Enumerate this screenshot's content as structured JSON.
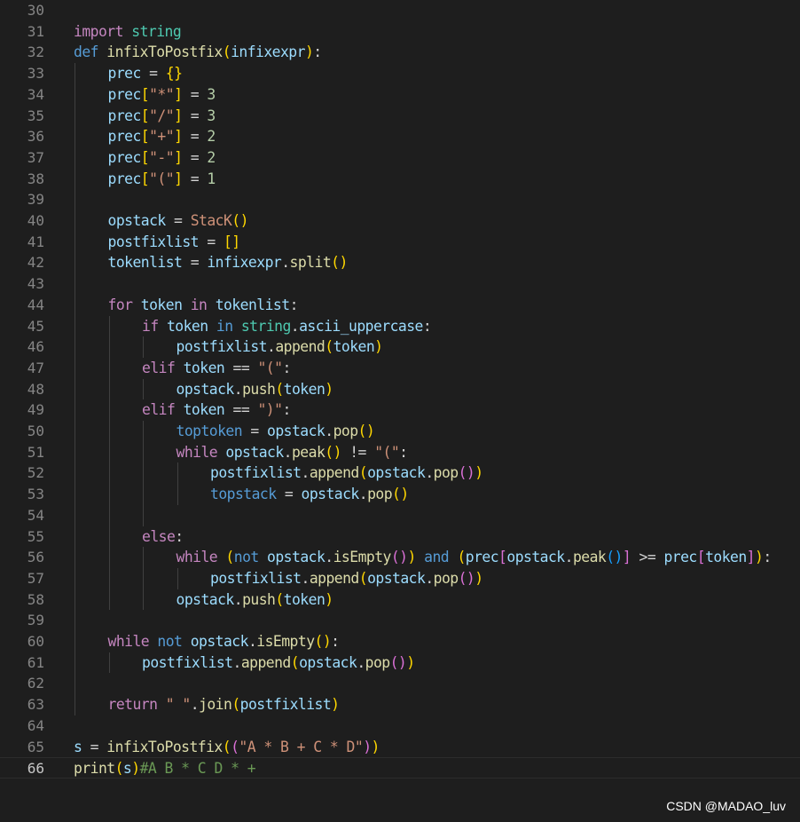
{
  "editor": {
    "language": "python",
    "current_line": 66,
    "lines": [
      {
        "n": 30,
        "indent": 0,
        "tokens": []
      },
      {
        "n": 31,
        "indent": 0,
        "tokens": [
          [
            "kw",
            "import"
          ],
          [
            "op",
            " "
          ],
          [
            "cls",
            "string"
          ]
        ]
      },
      {
        "n": 32,
        "indent": 0,
        "tokens": [
          [
            "def",
            "def"
          ],
          [
            "op",
            " "
          ],
          [
            "fn",
            "infixToPostfix"
          ],
          [
            "b1",
            "("
          ],
          [
            "var",
            "infixexpr"
          ],
          [
            "b1",
            ")"
          ],
          [
            "op",
            ":"
          ]
        ]
      },
      {
        "n": 33,
        "indent": 1,
        "tokens": [
          [
            "var",
            "prec"
          ],
          [
            "op",
            " = "
          ],
          [
            "b1",
            "{}"
          ]
        ]
      },
      {
        "n": 34,
        "indent": 1,
        "tokens": [
          [
            "var",
            "prec"
          ],
          [
            "b1",
            "["
          ],
          [
            "str",
            "\"*\""
          ],
          [
            "b1",
            "]"
          ],
          [
            "op",
            " = "
          ],
          [
            "num",
            "3"
          ]
        ]
      },
      {
        "n": 35,
        "indent": 1,
        "tokens": [
          [
            "var",
            "prec"
          ],
          [
            "b1",
            "["
          ],
          [
            "str",
            "\"/\""
          ],
          [
            "b1",
            "]"
          ],
          [
            "op",
            " = "
          ],
          [
            "num",
            "3"
          ]
        ]
      },
      {
        "n": 36,
        "indent": 1,
        "tokens": [
          [
            "var",
            "prec"
          ],
          [
            "b1",
            "["
          ],
          [
            "str",
            "\"+\""
          ],
          [
            "b1",
            "]"
          ],
          [
            "op",
            " = "
          ],
          [
            "num",
            "2"
          ]
        ]
      },
      {
        "n": 37,
        "indent": 1,
        "tokens": [
          [
            "var",
            "prec"
          ],
          [
            "b1",
            "["
          ],
          [
            "str",
            "\"-\""
          ],
          [
            "b1",
            "]"
          ],
          [
            "op",
            " = "
          ],
          [
            "num",
            "2"
          ]
        ]
      },
      {
        "n": 38,
        "indent": 1,
        "tokens": [
          [
            "var",
            "prec"
          ],
          [
            "b1",
            "["
          ],
          [
            "str",
            "\"(\""
          ],
          [
            "b1",
            "]"
          ],
          [
            "op",
            " = "
          ],
          [
            "num",
            "1"
          ]
        ]
      },
      {
        "n": 39,
        "indent": 1,
        "tokens": []
      },
      {
        "n": 40,
        "indent": 1,
        "tokens": [
          [
            "var",
            "opstack"
          ],
          [
            "op",
            " = "
          ],
          [
            "str",
            "StacK"
          ],
          [
            "b1",
            "()"
          ]
        ]
      },
      {
        "n": 41,
        "indent": 1,
        "tokens": [
          [
            "var",
            "postfixlist"
          ],
          [
            "op",
            " = "
          ],
          [
            "b1",
            "[]"
          ]
        ]
      },
      {
        "n": 42,
        "indent": 1,
        "tokens": [
          [
            "var",
            "tokenlist"
          ],
          [
            "op",
            " = "
          ],
          [
            "var",
            "infixexpr"
          ],
          [
            "op",
            "."
          ],
          [
            "fn",
            "split"
          ],
          [
            "b1",
            "()"
          ]
        ]
      },
      {
        "n": 43,
        "indent": 1,
        "tokens": []
      },
      {
        "n": 44,
        "indent": 1,
        "tokens": [
          [
            "kw",
            "for"
          ],
          [
            "op",
            " "
          ],
          [
            "var",
            "token"
          ],
          [
            "op",
            " "
          ],
          [
            "kw",
            "in"
          ],
          [
            "op",
            " "
          ],
          [
            "var",
            "tokenlist"
          ],
          [
            "op",
            ":"
          ]
        ]
      },
      {
        "n": 45,
        "indent": 2,
        "tokens": [
          [
            "kw",
            "if"
          ],
          [
            "op",
            " "
          ],
          [
            "var",
            "token"
          ],
          [
            "op",
            " "
          ],
          [
            "def",
            "in"
          ],
          [
            "op",
            " "
          ],
          [
            "cls",
            "string"
          ],
          [
            "op",
            "."
          ],
          [
            "var",
            "ascii_uppercase"
          ],
          [
            "op",
            ":"
          ]
        ]
      },
      {
        "n": 46,
        "indent": 3,
        "tokens": [
          [
            "var",
            "postfixlist"
          ],
          [
            "op",
            "."
          ],
          [
            "fn",
            "append"
          ],
          [
            "b1",
            "("
          ],
          [
            "var",
            "token"
          ],
          [
            "b1",
            ")"
          ]
        ]
      },
      {
        "n": 47,
        "indent": 2,
        "tokens": [
          [
            "kw",
            "elif"
          ],
          [
            "op",
            " "
          ],
          [
            "var",
            "token"
          ],
          [
            "op",
            " == "
          ],
          [
            "str",
            "\"(\""
          ],
          [
            "op",
            ":"
          ]
        ]
      },
      {
        "n": 48,
        "indent": 3,
        "tokens": [
          [
            "var",
            "opstack"
          ],
          [
            "op",
            "."
          ],
          [
            "fn",
            "push"
          ],
          [
            "b1",
            "("
          ],
          [
            "var",
            "token"
          ],
          [
            "b1",
            ")"
          ]
        ]
      },
      {
        "n": 49,
        "indent": 2,
        "tokens": [
          [
            "kw",
            "elif"
          ],
          [
            "op",
            " "
          ],
          [
            "var",
            "token"
          ],
          [
            "op",
            " == "
          ],
          [
            "str",
            "\")\""
          ],
          [
            "op",
            ":"
          ]
        ]
      },
      {
        "n": 50,
        "indent": 3,
        "tokens": [
          [
            "def",
            "toptoken"
          ],
          [
            "op",
            " = "
          ],
          [
            "var",
            "opstack"
          ],
          [
            "op",
            "."
          ],
          [
            "fn",
            "pop"
          ],
          [
            "b1",
            "()"
          ]
        ]
      },
      {
        "n": 51,
        "indent": 3,
        "tokens": [
          [
            "kw",
            "while"
          ],
          [
            "op",
            " "
          ],
          [
            "var",
            "opstack"
          ],
          [
            "op",
            "."
          ],
          [
            "fn",
            "peak"
          ],
          [
            "b1",
            "()"
          ],
          [
            "op",
            " != "
          ],
          [
            "str",
            "\"(\""
          ],
          [
            "op",
            ":"
          ]
        ]
      },
      {
        "n": 52,
        "indent": 4,
        "tokens": [
          [
            "var",
            "postfixlist"
          ],
          [
            "op",
            "."
          ],
          [
            "fn",
            "append"
          ],
          [
            "b1",
            "("
          ],
          [
            "var",
            "opstack"
          ],
          [
            "op",
            "."
          ],
          [
            "fn",
            "pop"
          ],
          [
            "b2",
            "()"
          ],
          [
            "b1",
            ")"
          ]
        ]
      },
      {
        "n": 53,
        "indent": 4,
        "tokens": [
          [
            "def",
            "topstack"
          ],
          [
            "op",
            " = "
          ],
          [
            "var",
            "opstack"
          ],
          [
            "op",
            "."
          ],
          [
            "fn",
            "pop"
          ],
          [
            "b1",
            "()"
          ]
        ]
      },
      {
        "n": 54,
        "indent": 3,
        "tokens": []
      },
      {
        "n": 55,
        "indent": 2,
        "tokens": [
          [
            "kw",
            "else"
          ],
          [
            "op",
            ":"
          ]
        ]
      },
      {
        "n": 56,
        "indent": 3,
        "tokens": [
          [
            "kw",
            "while"
          ],
          [
            "op",
            " "
          ],
          [
            "b1",
            "("
          ],
          [
            "def",
            "not"
          ],
          [
            "op",
            " "
          ],
          [
            "var",
            "opstack"
          ],
          [
            "op",
            "."
          ],
          [
            "fn",
            "isEmpty"
          ],
          [
            "b2",
            "()"
          ],
          [
            "b1",
            ")"
          ],
          [
            "op",
            " "
          ],
          [
            "def",
            "and"
          ],
          [
            "op",
            " "
          ],
          [
            "b1",
            "("
          ],
          [
            "var",
            "prec"
          ],
          [
            "b2",
            "["
          ],
          [
            "var",
            "opstack"
          ],
          [
            "op",
            "."
          ],
          [
            "fn",
            "peak"
          ],
          [
            "b3",
            "()"
          ],
          [
            "b2",
            "]"
          ],
          [
            "op",
            " >= "
          ],
          [
            "var",
            "prec"
          ],
          [
            "b2",
            "["
          ],
          [
            "var",
            "token"
          ],
          [
            "b2",
            "]"
          ],
          [
            "b1",
            ")"
          ],
          [
            "op",
            ":"
          ]
        ]
      },
      {
        "n": 57,
        "indent": 4,
        "tokens": [
          [
            "var",
            "postfixlist"
          ],
          [
            "op",
            "."
          ],
          [
            "fn",
            "append"
          ],
          [
            "b1",
            "("
          ],
          [
            "var",
            "opstack"
          ],
          [
            "op",
            "."
          ],
          [
            "fn",
            "pop"
          ],
          [
            "b2",
            "()"
          ],
          [
            "b1",
            ")"
          ]
        ]
      },
      {
        "n": 58,
        "indent": 3,
        "tokens": [
          [
            "var",
            "opstack"
          ],
          [
            "op",
            "."
          ],
          [
            "fn",
            "push"
          ],
          [
            "b1",
            "("
          ],
          [
            "var",
            "token"
          ],
          [
            "b1",
            ")"
          ]
        ]
      },
      {
        "n": 59,
        "indent": 1,
        "tokens": []
      },
      {
        "n": 60,
        "indent": 1,
        "tokens": [
          [
            "kw",
            "while"
          ],
          [
            "op",
            " "
          ],
          [
            "def",
            "not"
          ],
          [
            "op",
            " "
          ],
          [
            "var",
            "opstack"
          ],
          [
            "op",
            "."
          ],
          [
            "fn",
            "isEmpty"
          ],
          [
            "b1",
            "()"
          ],
          [
            "op",
            ":"
          ]
        ]
      },
      {
        "n": 61,
        "indent": 2,
        "tokens": [
          [
            "var",
            "postfixlist"
          ],
          [
            "op",
            "."
          ],
          [
            "fn",
            "append"
          ],
          [
            "b1",
            "("
          ],
          [
            "var",
            "opstack"
          ],
          [
            "op",
            "."
          ],
          [
            "fn",
            "pop"
          ],
          [
            "b2",
            "()"
          ],
          [
            "b1",
            ")"
          ]
        ]
      },
      {
        "n": 62,
        "indent": 1,
        "tokens": []
      },
      {
        "n": 63,
        "indent": 1,
        "tokens": [
          [
            "kw",
            "return"
          ],
          [
            "op",
            " "
          ],
          [
            "str",
            "\" \""
          ],
          [
            "op",
            "."
          ],
          [
            "fn",
            "join"
          ],
          [
            "b1",
            "("
          ],
          [
            "var",
            "postfixlist"
          ],
          [
            "b1",
            ")"
          ]
        ]
      },
      {
        "n": 64,
        "indent": 0,
        "tokens": []
      },
      {
        "n": 65,
        "indent": 0,
        "tokens": [
          [
            "var",
            "s"
          ],
          [
            "op",
            " = "
          ],
          [
            "fn",
            "infixToPostfix"
          ],
          [
            "b1",
            "("
          ],
          [
            "b2",
            "("
          ],
          [
            "str",
            "\"A * B + C * D\""
          ],
          [
            "b2",
            ")"
          ],
          [
            "b1",
            ")"
          ]
        ]
      },
      {
        "n": 66,
        "indent": 0,
        "tokens": [
          [
            "fn",
            "print"
          ],
          [
            "b1",
            "("
          ],
          [
            "var",
            "s"
          ],
          [
            "b1",
            ")"
          ],
          [
            "cmt",
            "#A B * C D * +"
          ]
        ]
      }
    ]
  },
  "watermark": "CSDN @MADAO_luv"
}
